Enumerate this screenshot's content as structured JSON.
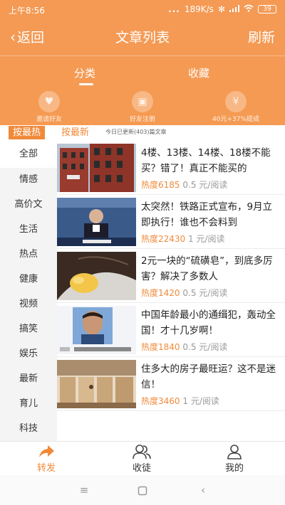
{
  "status_bar": {
    "time": "上午8:56",
    "dots": "...",
    "net_speed": "189K/s",
    "battery": "39"
  },
  "nav": {
    "back_label": "返回",
    "title": "文章列表",
    "refresh_label": "刷新"
  },
  "tabs": [
    {
      "label": "分类",
      "active": true
    },
    {
      "label": "收藏",
      "active": false
    }
  ],
  "promos": [
    {
      "label": "邀请好友"
    },
    {
      "label": "好友注册"
    },
    {
      "label": "40元+37%提成"
    }
  ],
  "sort": {
    "hot_label": "按最热",
    "new_label": "按最新",
    "info": "今日已更新(403)篇文章"
  },
  "sidebar": {
    "items": [
      {
        "label": "全部",
        "active": true
      },
      {
        "label": "情感"
      },
      {
        "label": "高价文"
      },
      {
        "label": "生活"
      },
      {
        "label": "热点"
      },
      {
        "label": "健康"
      },
      {
        "label": "视频"
      },
      {
        "label": "搞笑"
      },
      {
        "label": "娱乐"
      },
      {
        "label": "最新"
      },
      {
        "label": "育儿"
      },
      {
        "label": "科技"
      }
    ]
  },
  "articles": [
    {
      "title": "4楼、13楼、14楼、18楼不能买？错了！真正不能买的",
      "heat_label": "热度6185",
      "price": "0.5 元/阅读"
    },
    {
      "title": "太突然！铁路正式宣布，9月立即执行！谁也不会料到",
      "heat_label": "热度22430",
      "price": "1 元/阅读"
    },
    {
      "title": "2元一块的“硫磺皂”，到底多厉害？解决了多数人",
      "heat_label": "热度1420",
      "price": "0.5 元/阅读"
    },
    {
      "title": "中国年龄最小的通缉犯，轰动全国！才十几岁啊！",
      "heat_label": "热度1840",
      "price": "0.5 元/阅读"
    },
    {
      "title": "住多大的房子最旺运？这不是迷信！",
      "heat_label": "热度3460",
      "price": "1 元/阅读"
    }
  ],
  "bottom_nav": [
    {
      "label": "转发",
      "active": true
    },
    {
      "label": "收徒"
    },
    {
      "label": "我的"
    }
  ],
  "colors": {
    "accent": "#f08a3a",
    "header_bg": "#f49a55"
  }
}
